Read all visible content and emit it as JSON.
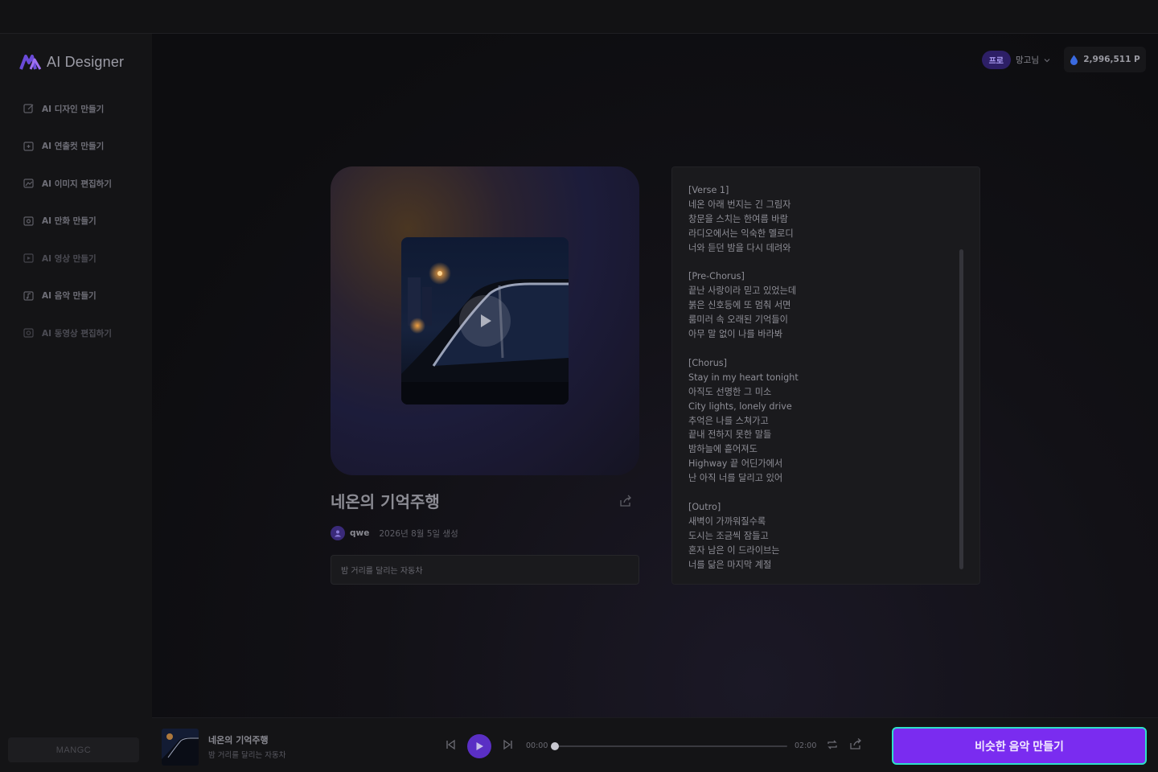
{
  "app": {
    "logo_text": "AI Designer",
    "brand_footer": "MANGC"
  },
  "sidebar": {
    "items": [
      {
        "label": "AI 디자인 만들기",
        "icon": "edit-icon"
      },
      {
        "label": "AI 연출컷 만들기",
        "icon": "image-plus-icon"
      },
      {
        "label": "AI 이미지 편집하기",
        "icon": "image-edit-icon"
      },
      {
        "label": "AI 만화 만들기",
        "icon": "comic-icon"
      },
      {
        "label": "AI 영상 만들기",
        "icon": "video-icon"
      },
      {
        "label": "AI 음악 만들기",
        "icon": "music-icon"
      },
      {
        "label": "AI 동영상 편집하기",
        "icon": "video-edit-icon"
      }
    ]
  },
  "header": {
    "plan_badge": "프로",
    "user_name": "망고님",
    "points": "2,996,511 P"
  },
  "song": {
    "title": "네온의 기억주행",
    "author": "qwe",
    "created": "2026년 8월 5일 생성",
    "prompt": "밤 거리를 달리는 자동차",
    "lyrics": "[Verse 1]\n네온 아래 번지는 긴 그림자\n창문을 스치는 한여름 바람\n라디오에서는 익숙한 멜로디\n너와 듣던 밤을 다시 데려와\n\n[Pre-Chorus]\n끝난 사랑이라 믿고 있었는데\n붉은 신호등에 또 멈춰 서면\n룸미러 속 오래된 기억들이\n아무 말 없이 나를 바라봐\n\n[Chorus]\nStay in my heart tonight\n아직도 선명한 그 미소\nCity lights, lonely drive\n추억은 나를 스쳐가고\n끝내 전하지 못한 말들\n밤하늘에 흩어져도\nHighway 끝 어딘가에서\n난 아직 너를 달리고 있어\n\n[Outro]\n새벽이 가까워질수록\n도시는 조금씩 잠들고\n혼자 남은 이 드라이브는\n너를 닮은 마지막 계절"
  },
  "player": {
    "title": "네온의 기억주행",
    "subtitle": "밤 거리를 달리는 자동차",
    "current_time": "00:00",
    "total_time": "02:00",
    "progress": 0,
    "cta_label": "비슷한 음악 만들기"
  },
  "colors": {
    "accent": "#7a2cf0",
    "cta_border": "#2ee0c8",
    "pro_badge": "#2d1f66"
  }
}
